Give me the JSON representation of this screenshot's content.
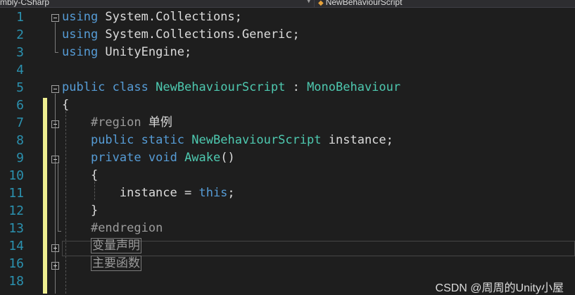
{
  "toolbar": {
    "project_combo": "mbly-CSharp",
    "class_combo": "NewBehaviourScript",
    "class_icon": "class-icon"
  },
  "editor": {
    "lines": [
      {
        "number": "1",
        "tokens": [
          {
            "t": "using",
            "c": "kw"
          },
          {
            "t": " System.Collections;",
            "c": "tx"
          }
        ]
      },
      {
        "number": "2",
        "tokens": [
          {
            "t": "using",
            "c": "kw"
          },
          {
            "t": " System.Collections.Generic;",
            "c": "tx"
          }
        ]
      },
      {
        "number": "3",
        "tokens": [
          {
            "t": "using",
            "c": "kw"
          },
          {
            "t": " UnityEngine;",
            "c": "tx"
          }
        ]
      },
      {
        "number": "4",
        "tokens": []
      },
      {
        "number": "5",
        "tokens": [
          {
            "t": "public",
            "c": "kw"
          },
          {
            "t": " ",
            "c": "tx"
          },
          {
            "t": "class",
            "c": "kw"
          },
          {
            "t": " ",
            "c": "tx"
          },
          {
            "t": "NewBehaviourScript",
            "c": "ty"
          },
          {
            "t": " : ",
            "c": "tx"
          },
          {
            "t": "MonoBehaviour",
            "c": "ty"
          }
        ]
      },
      {
        "number": "6",
        "tokens": [
          {
            "t": "{",
            "c": "tx"
          }
        ]
      },
      {
        "number": "7",
        "tokens": [
          {
            "t": "    ",
            "c": "tx"
          },
          {
            "t": "#region ",
            "c": "pp"
          },
          {
            "t": "单例",
            "c": "tx cjk"
          }
        ]
      },
      {
        "number": "8",
        "tokens": [
          {
            "t": "    ",
            "c": "tx"
          },
          {
            "t": "public",
            "c": "kw"
          },
          {
            "t": " ",
            "c": "tx"
          },
          {
            "t": "static",
            "c": "kw"
          },
          {
            "t": " ",
            "c": "tx"
          },
          {
            "t": "NewBehaviourScript",
            "c": "ty"
          },
          {
            "t": " instance;",
            "c": "tx"
          }
        ]
      },
      {
        "number": "9",
        "tokens": [
          {
            "t": "    ",
            "c": "tx"
          },
          {
            "t": "private",
            "c": "kw"
          },
          {
            "t": " ",
            "c": "tx"
          },
          {
            "t": "void",
            "c": "kw"
          },
          {
            "t": " ",
            "c": "tx"
          },
          {
            "t": "Awake",
            "c": "ty"
          },
          {
            "t": "()",
            "c": "tx"
          }
        ]
      },
      {
        "number": "10",
        "tokens": [
          {
            "t": "    {",
            "c": "tx"
          }
        ]
      },
      {
        "number": "11",
        "tokens": [
          {
            "t": "        instance = ",
            "c": "tx"
          },
          {
            "t": "this",
            "c": "kw"
          },
          {
            "t": ";",
            "c": "tx"
          }
        ]
      },
      {
        "number": "12",
        "tokens": [
          {
            "t": "    }",
            "c": "tx"
          }
        ]
      },
      {
        "number": "13",
        "tokens": [
          {
            "t": "    ",
            "c": "tx"
          },
          {
            "t": "#endregion",
            "c": "pp"
          }
        ]
      },
      {
        "number": "14",
        "tokens": [
          {
            "t": "    ",
            "c": "tx"
          },
          {
            "t": "变量声明",
            "c": "collapsed cjk"
          }
        ]
      },
      {
        "number": "16",
        "tokens": [
          {
            "t": "    ",
            "c": "tx"
          },
          {
            "t": "主要函数",
            "c": "collapsed cjk"
          }
        ]
      },
      {
        "number": "18",
        "tokens": []
      }
    ]
  },
  "watermark": "CSDN @周周的Unity小屋",
  "colors": {
    "background": "#1e1e1e",
    "line_number": "#2b91af",
    "keyword": "#569cd6",
    "type": "#4ec9b0",
    "preprocessor": "#9b9b9b",
    "text": "#dcdcdc",
    "change_bar": "#efef91"
  }
}
